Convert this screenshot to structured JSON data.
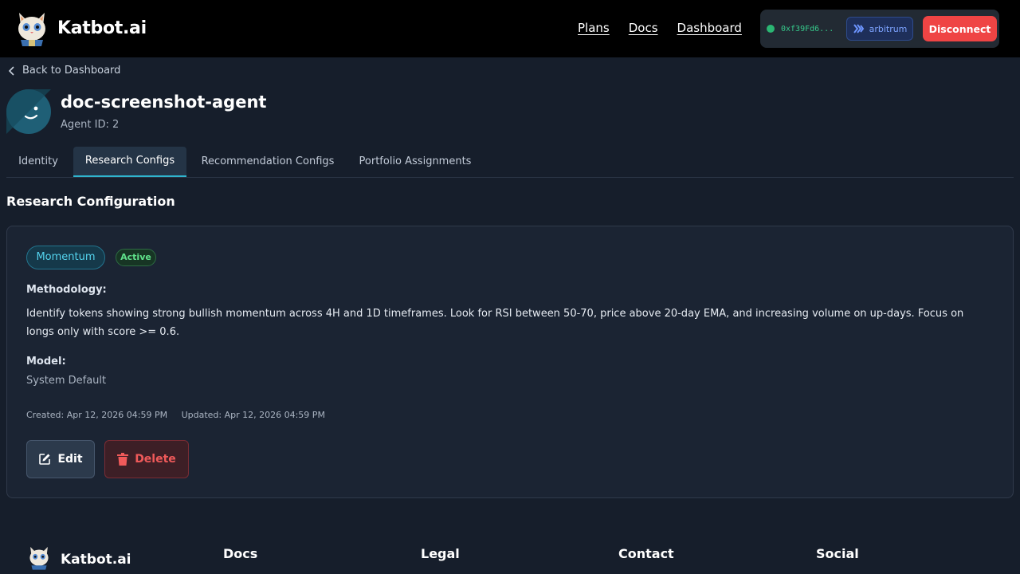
{
  "header": {
    "brand": "Katbot.ai",
    "nav": [
      "Plans",
      "Docs",
      "Dashboard"
    ],
    "wallet": {
      "address": "0xf39Fd6...",
      "chain": "arbitrum",
      "disconnect_label": "Disconnect"
    }
  },
  "back_link": "Back to Dashboard",
  "agent": {
    "name": "doc-screenshot-agent",
    "id_text": "Agent ID: 2"
  },
  "tabs": [
    {
      "label": "Identity",
      "active": false
    },
    {
      "label": "Research Configs",
      "active": true
    },
    {
      "label": "Recommendation Configs",
      "active": false
    },
    {
      "label": "Portfolio Assignments",
      "active": false
    }
  ],
  "section_title": "Research Configuration",
  "config": {
    "strategy": "Momentum",
    "status": "Active",
    "methodology_label": "Methodology:",
    "methodology": "Identify tokens showing strong bullish momentum across 4H and 1D timeframes. Look for RSI between 50-70, price above 20-day EMA, and increasing volume on up-days. Focus on longs only with score >= 0.6.",
    "model_label": "Model:",
    "model": "System Default",
    "created": "Created: Apr 12, 2026 04:59 PM",
    "updated": "Updated: Apr 12, 2026 04:59 PM",
    "edit_label": "Edit",
    "delete_label": "Delete"
  },
  "footer": {
    "brand": "Katbot.ai",
    "columns": [
      "Docs",
      "Legal",
      "Contact",
      "Social"
    ]
  },
  "colors": {
    "accent": "#2fb5ce",
    "danger": "#ef4444",
    "success": "#5fe08a",
    "background": "#161e2b"
  }
}
